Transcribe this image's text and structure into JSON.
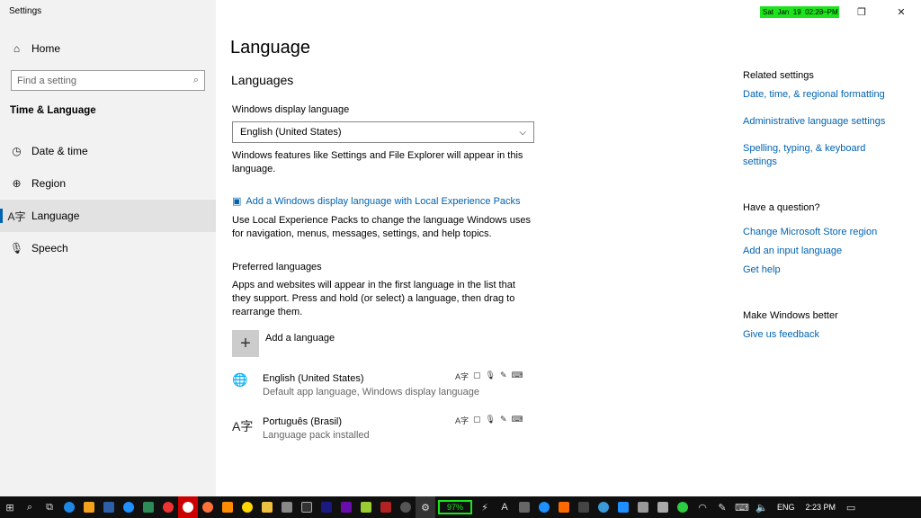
{
  "app": {
    "title": "Settings"
  },
  "window_controls": {
    "minimize_symbol": "—",
    "restore_symbol": "❐",
    "close_symbol": "✕"
  },
  "clock_badge": {
    "text": "Sat  Jan  19  02:23  PM"
  },
  "sidebar": {
    "home_label": "Home",
    "search_placeholder": "Find a setting",
    "section_title": "Time & Language",
    "items": [
      {
        "label": "Date & time",
        "icon": "clock-icon"
      },
      {
        "label": "Region",
        "icon": "globe-icon"
      },
      {
        "label": "Language",
        "icon": "language-icon"
      },
      {
        "label": "Speech",
        "icon": "microphone-icon"
      }
    ]
  },
  "main": {
    "title": "Language",
    "languages_heading": "Languages",
    "display_language_label": "Windows display language",
    "display_language_value": "English (United States)",
    "display_language_desc_1": "Windows features like Settings and File Explorer will appear in this",
    "display_language_desc_2": "language.",
    "lxp_link": "Add a Windows display language with Local Experience Packs",
    "lxp_desc_1": "Use Local Experience Packs to change the language Windows uses",
    "lxp_desc_2": "for navigation, menus, messages, settings, and help topics.",
    "preferred_heading": "Preferred languages",
    "preferred_desc_1": "Apps and websites will appear in the first language in the list that",
    "preferred_desc_2": "they support. Press and hold (or select) a language, then drag to",
    "preferred_desc_3": "rearrange them.",
    "add_language_label": "Add a language",
    "languages": [
      {
        "name": "English (United States)",
        "status": "Default app language, Windows display language"
      },
      {
        "name": "Português (Brasil)",
        "status": "Language pack installed"
      }
    ]
  },
  "related": {
    "heading": "Related settings",
    "link_1": "Date, time, & regional formatting",
    "link_2": "Administrative language settings",
    "link_3a": "Spelling, typing, & keyboard",
    "link_3b": "settings",
    "question_heading": "Have a question?",
    "q_link_1": "Change Microsoft Store region",
    "q_link_2": "Add an input language",
    "q_link_3": "Get help",
    "better_heading": "Make Windows better",
    "feedback_link": "Give us feedback"
  },
  "taskbar": {
    "battery_percent": "97%",
    "input_language": "ENG",
    "time": "2:23 PM"
  },
  "colors": {
    "accent": "#0063b1",
    "badge_green": "#1ce31c",
    "taskbar": "#101010"
  }
}
